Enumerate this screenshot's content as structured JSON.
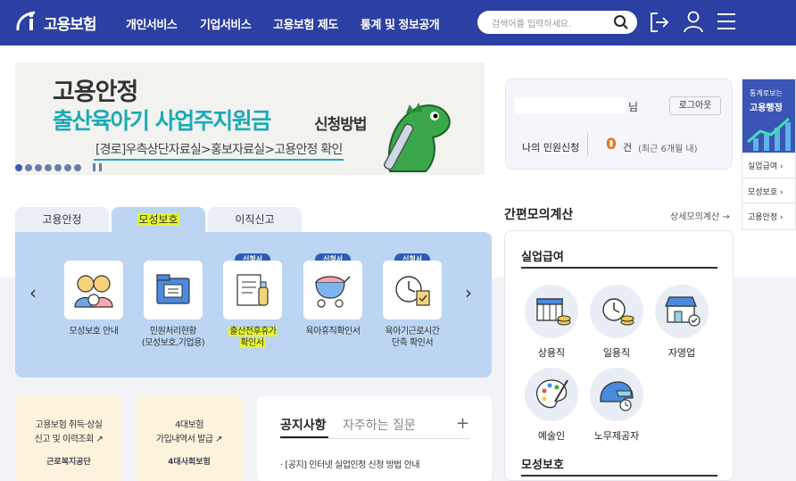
{
  "header": {
    "logo_text": "고용보험",
    "nav": [
      "개인서비스",
      "기업서비스",
      "고용보험 제도",
      "통계 및 정보공개"
    ],
    "search_placeholder": "검색어를 입력하세요."
  },
  "banner": {
    "line1": "고용안정",
    "line2": "출산육아기 사업주지원금",
    "line2_suffix": "신청방법",
    "line3": "[경로]우측상단자료실>홍보자료실>고용안정 확인"
  },
  "login": {
    "name_suffix": "님",
    "logout_label": "로그아웃",
    "my_label": "나의 민원신청",
    "my_count": "0",
    "my_unit": "건",
    "my_note": "(최근 6개월 내)"
  },
  "side": {
    "title_small": "통계로보는",
    "title_big": "고용행정",
    "items": [
      "실업급여 ›",
      "모성보호 ›",
      "고용안정 ›"
    ]
  },
  "tabs": [
    "고용안정",
    "모성보호",
    "이직신고"
  ],
  "services": [
    {
      "label": "모성보호 안내",
      "badge": ""
    },
    {
      "label": "민원처리현황\n(모성보호,기업용)",
      "badge": ""
    },
    {
      "label": "출산전후휴가\n확인서",
      "badge": "신청서"
    },
    {
      "label": "육아휴직확인서",
      "badge": "신청서"
    },
    {
      "label": "육아기근로시간\n단축 확인서",
      "badge": "신청서"
    }
  ],
  "shortcuts": [
    {
      "title": "고용보험 취득·상실\n신고 및 이력조회 ↗",
      "brand": "근로복지공단"
    },
    {
      "title": "4대보험\n가입내역서 발급 ↗",
      "brand": "4대사회보험"
    }
  ],
  "notice": {
    "tab1": "공지사항",
    "tab2": "자주하는 질문",
    "plus": "+",
    "item": "· [공지] 인터넷 실업인정 신청 방법 안내"
  },
  "calc": {
    "title": "간편모의계산",
    "link": "상세모의계산 →",
    "section1": "실업급여",
    "items": [
      "상용직",
      "일용직",
      "자영업",
      "예술인",
      "노무제공자"
    ],
    "section2": "모성보호"
  },
  "colors": {
    "header": "#2c3fa2",
    "accent": "#1ba9b8",
    "panel": "#bcd5f3",
    "badge": "#2f5cb6",
    "highlight": "#e6f531"
  }
}
